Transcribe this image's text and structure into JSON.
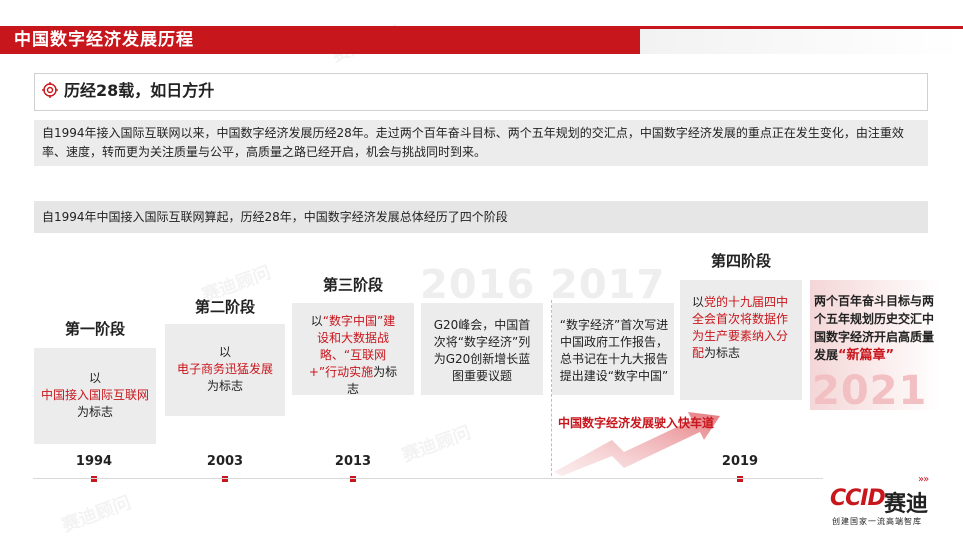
{
  "header": {
    "title": "中国数字经济发展历程"
  },
  "subtitle": {
    "text": "历经28载，如日方升"
  },
  "intro": {
    "text": "自1994年接入国际互联网以来，中国数字经济发展历经28年。走过两个百年奋斗目标、两个五年规划的交汇点，中国数字经济发展的重点正在发生变化，由注重效率、速度，转而更为关注质量与公平，高质量之路已经开启，机会与挑战同时到来。"
  },
  "stage_summary": {
    "text": "自1994年中国接入国际互联网算起，历经28年，中国数字经济发展总体经历了四个阶段"
  },
  "stages": {
    "s1": {
      "label": "第一阶段",
      "pre": "以",
      "highlight": "中国接入国际互联网",
      "post": "为标志",
      "year": "1994"
    },
    "s2": {
      "label": "第二阶段",
      "pre": "以",
      "highlight": "电子商务迅猛发展",
      "post": "为标志",
      "year": "2003"
    },
    "s3": {
      "label": "第三阶段",
      "pre": "以",
      "highlight": "“数字中国”建设和大数据战略、“互联网+”行动实施",
      "post": "为标志",
      "year": "2013"
    },
    "g20": {
      "text": "G20峰会，中国首次将“数字经济”列为G20创新增长蓝图重要议题",
      "bg_year": "2016"
    },
    "report": {
      "text": "“数字经济”首次写进中国政府工作报告，总书记在十九大报告提出建设“数字中国”",
      "bg_year": "2017"
    },
    "fast_lane": "中国数字经济发展驶入快车道",
    "s4": {
      "label": "第四阶段",
      "pre": "以",
      "highlight": "党的十九届四中全会首次将数据作为生产要素纳入分配",
      "post": "为标志",
      "year": "2019"
    },
    "new": {
      "text": "两个百年奋斗目标与两个五年规划历史交汇中国数字经济开启高质量发展",
      "highlight": "“新篇章”",
      "bg_year": "2021"
    }
  },
  "logo": {
    "brand_latin": "CCID",
    "brand_cn": "赛迪",
    "tagline": "创建国家一流高端智库",
    "arrows": "»»"
  },
  "watermark": {
    "text": "赛迪顾问"
  },
  "colors": {
    "accent": "#c8161d",
    "box_bg": "#ececec",
    "text": "#222222"
  }
}
